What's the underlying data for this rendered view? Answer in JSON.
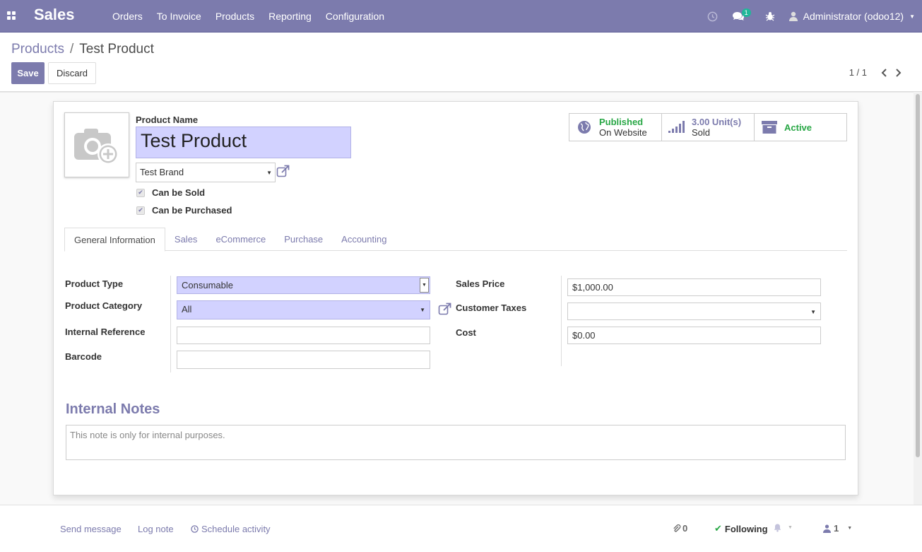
{
  "navbar": {
    "app_name": "Sales",
    "menu": [
      "Orders",
      "To Invoice",
      "Products",
      "Reporting",
      "Configuration"
    ],
    "messages_count": "1",
    "user": "Administrator (odoo12)"
  },
  "breadcrumb": {
    "parent": "Products",
    "separator": "/",
    "current": "Test Product"
  },
  "toolbar": {
    "save_label": "Save",
    "discard_label": "Discard"
  },
  "pager": {
    "value": "1 / 1"
  },
  "product": {
    "name_label": "Product Name",
    "name": "Test Product",
    "brand": "Test Brand",
    "can_be_sold_label": "Can be Sold",
    "can_be_purchased_label": "Can be Purchased"
  },
  "stats": {
    "published_title": "Published",
    "published_sub": "On Website",
    "sold_title": "3.00 Unit(s)",
    "sold_sub": "Sold",
    "active_label": "Active"
  },
  "tabs": [
    "General Information",
    "Sales",
    "eCommerce",
    "Purchase",
    "Accounting"
  ],
  "general": {
    "product_type_label": "Product Type",
    "product_type": "Consumable",
    "product_category_label": "Product Category",
    "product_category": "All",
    "internal_reference_label": "Internal Reference",
    "internal_reference": "",
    "barcode_label": "Barcode",
    "barcode": "",
    "sales_price_label": "Sales Price",
    "sales_price": "$1,000.00",
    "customer_taxes_label": "Customer Taxes",
    "customer_taxes": "",
    "cost_label": "Cost",
    "cost": "$0.00"
  },
  "notes": {
    "title": "Internal Notes",
    "placeholder": "This note is only for internal purposes."
  },
  "chatter": {
    "send_message": "Send message",
    "log_note": "Log note",
    "schedule_activity": "Schedule activity",
    "attachments": "0",
    "following": "Following",
    "followers": "1"
  },
  "colors": {
    "brand": "#7c7bad",
    "required_field": "#d2d2ff",
    "success": "#28a745"
  }
}
